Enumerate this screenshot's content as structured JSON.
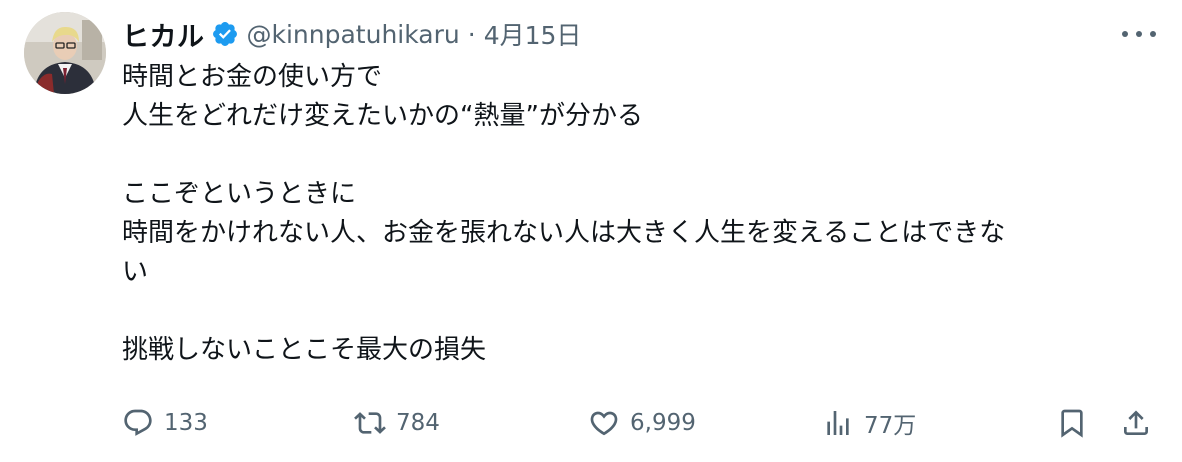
{
  "author": {
    "display_name": "ヒカル",
    "handle": "@kinnpatuhikaru",
    "separator": "·",
    "date": "4月15日",
    "verified_color": "#1d9bf0"
  },
  "post": {
    "lines": [
      "時間とお金の使い方で",
      "人生をどれだけ変えたいかの“熱量”が分かる",
      "",
      "ここぞというときに",
      "時間をかけれない人、お金を張れない人は大きく人生を変えることはできな",
      "い",
      "",
      "挑戦しないことこそ最大の損失"
    ]
  },
  "actions": {
    "reply": {
      "icon": "reply-icon",
      "count": "133"
    },
    "repost": {
      "icon": "repost-icon",
      "count": "784"
    },
    "like": {
      "icon": "heart-icon",
      "count": "6,999"
    },
    "views": {
      "icon": "views-icon",
      "count": "77万"
    },
    "bookmark": {
      "icon": "bookmark-icon"
    },
    "share": {
      "icon": "share-icon"
    }
  },
  "colors": {
    "text": "#0f1419",
    "secondary": "#536471",
    "accent": "#1d9bf0"
  }
}
